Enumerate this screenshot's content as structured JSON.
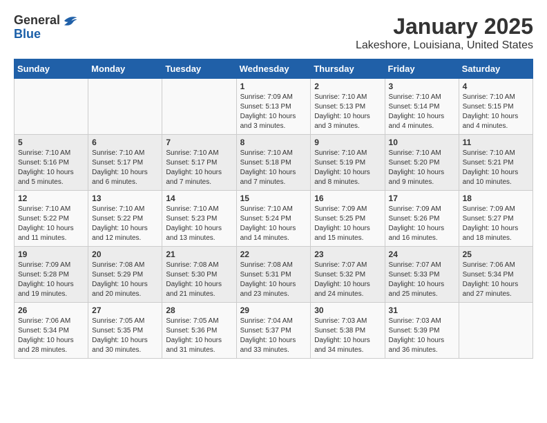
{
  "logo": {
    "general": "General",
    "blue": "Blue"
  },
  "title": {
    "month_year": "January 2025",
    "location": "Lakeshore, Louisiana, United States"
  },
  "weekdays": [
    "Sunday",
    "Monday",
    "Tuesday",
    "Wednesday",
    "Thursday",
    "Friday",
    "Saturday"
  ],
  "weeks": [
    [
      {
        "day": "",
        "info": ""
      },
      {
        "day": "",
        "info": ""
      },
      {
        "day": "",
        "info": ""
      },
      {
        "day": "1",
        "info": "Sunrise: 7:09 AM\nSunset: 5:13 PM\nDaylight: 10 hours\nand 3 minutes."
      },
      {
        "day": "2",
        "info": "Sunrise: 7:10 AM\nSunset: 5:13 PM\nDaylight: 10 hours\nand 3 minutes."
      },
      {
        "day": "3",
        "info": "Sunrise: 7:10 AM\nSunset: 5:14 PM\nDaylight: 10 hours\nand 4 minutes."
      },
      {
        "day": "4",
        "info": "Sunrise: 7:10 AM\nSunset: 5:15 PM\nDaylight: 10 hours\nand 4 minutes."
      }
    ],
    [
      {
        "day": "5",
        "info": "Sunrise: 7:10 AM\nSunset: 5:16 PM\nDaylight: 10 hours\nand 5 minutes."
      },
      {
        "day": "6",
        "info": "Sunrise: 7:10 AM\nSunset: 5:17 PM\nDaylight: 10 hours\nand 6 minutes."
      },
      {
        "day": "7",
        "info": "Sunrise: 7:10 AM\nSunset: 5:17 PM\nDaylight: 10 hours\nand 7 minutes."
      },
      {
        "day": "8",
        "info": "Sunrise: 7:10 AM\nSunset: 5:18 PM\nDaylight: 10 hours\nand 7 minutes."
      },
      {
        "day": "9",
        "info": "Sunrise: 7:10 AM\nSunset: 5:19 PM\nDaylight: 10 hours\nand 8 minutes."
      },
      {
        "day": "10",
        "info": "Sunrise: 7:10 AM\nSunset: 5:20 PM\nDaylight: 10 hours\nand 9 minutes."
      },
      {
        "day": "11",
        "info": "Sunrise: 7:10 AM\nSunset: 5:21 PM\nDaylight: 10 hours\nand 10 minutes."
      }
    ],
    [
      {
        "day": "12",
        "info": "Sunrise: 7:10 AM\nSunset: 5:22 PM\nDaylight: 10 hours\nand 11 minutes."
      },
      {
        "day": "13",
        "info": "Sunrise: 7:10 AM\nSunset: 5:22 PM\nDaylight: 10 hours\nand 12 minutes."
      },
      {
        "day": "14",
        "info": "Sunrise: 7:10 AM\nSunset: 5:23 PM\nDaylight: 10 hours\nand 13 minutes."
      },
      {
        "day": "15",
        "info": "Sunrise: 7:10 AM\nSunset: 5:24 PM\nDaylight: 10 hours\nand 14 minutes."
      },
      {
        "day": "16",
        "info": "Sunrise: 7:09 AM\nSunset: 5:25 PM\nDaylight: 10 hours\nand 15 minutes."
      },
      {
        "day": "17",
        "info": "Sunrise: 7:09 AM\nSunset: 5:26 PM\nDaylight: 10 hours\nand 16 minutes."
      },
      {
        "day": "18",
        "info": "Sunrise: 7:09 AM\nSunset: 5:27 PM\nDaylight: 10 hours\nand 18 minutes."
      }
    ],
    [
      {
        "day": "19",
        "info": "Sunrise: 7:09 AM\nSunset: 5:28 PM\nDaylight: 10 hours\nand 19 minutes."
      },
      {
        "day": "20",
        "info": "Sunrise: 7:08 AM\nSunset: 5:29 PM\nDaylight: 10 hours\nand 20 minutes."
      },
      {
        "day": "21",
        "info": "Sunrise: 7:08 AM\nSunset: 5:30 PM\nDaylight: 10 hours\nand 21 minutes."
      },
      {
        "day": "22",
        "info": "Sunrise: 7:08 AM\nSunset: 5:31 PM\nDaylight: 10 hours\nand 23 minutes."
      },
      {
        "day": "23",
        "info": "Sunrise: 7:07 AM\nSunset: 5:32 PM\nDaylight: 10 hours\nand 24 minutes."
      },
      {
        "day": "24",
        "info": "Sunrise: 7:07 AM\nSunset: 5:33 PM\nDaylight: 10 hours\nand 25 minutes."
      },
      {
        "day": "25",
        "info": "Sunrise: 7:06 AM\nSunset: 5:34 PM\nDaylight: 10 hours\nand 27 minutes."
      }
    ],
    [
      {
        "day": "26",
        "info": "Sunrise: 7:06 AM\nSunset: 5:34 PM\nDaylight: 10 hours\nand 28 minutes."
      },
      {
        "day": "27",
        "info": "Sunrise: 7:05 AM\nSunset: 5:35 PM\nDaylight: 10 hours\nand 30 minutes."
      },
      {
        "day": "28",
        "info": "Sunrise: 7:05 AM\nSunset: 5:36 PM\nDaylight: 10 hours\nand 31 minutes."
      },
      {
        "day": "29",
        "info": "Sunrise: 7:04 AM\nSunset: 5:37 PM\nDaylight: 10 hours\nand 33 minutes."
      },
      {
        "day": "30",
        "info": "Sunrise: 7:03 AM\nSunset: 5:38 PM\nDaylight: 10 hours\nand 34 minutes."
      },
      {
        "day": "31",
        "info": "Sunrise: 7:03 AM\nSunset: 5:39 PM\nDaylight: 10 hours\nand 36 minutes."
      },
      {
        "day": "",
        "info": ""
      }
    ]
  ]
}
